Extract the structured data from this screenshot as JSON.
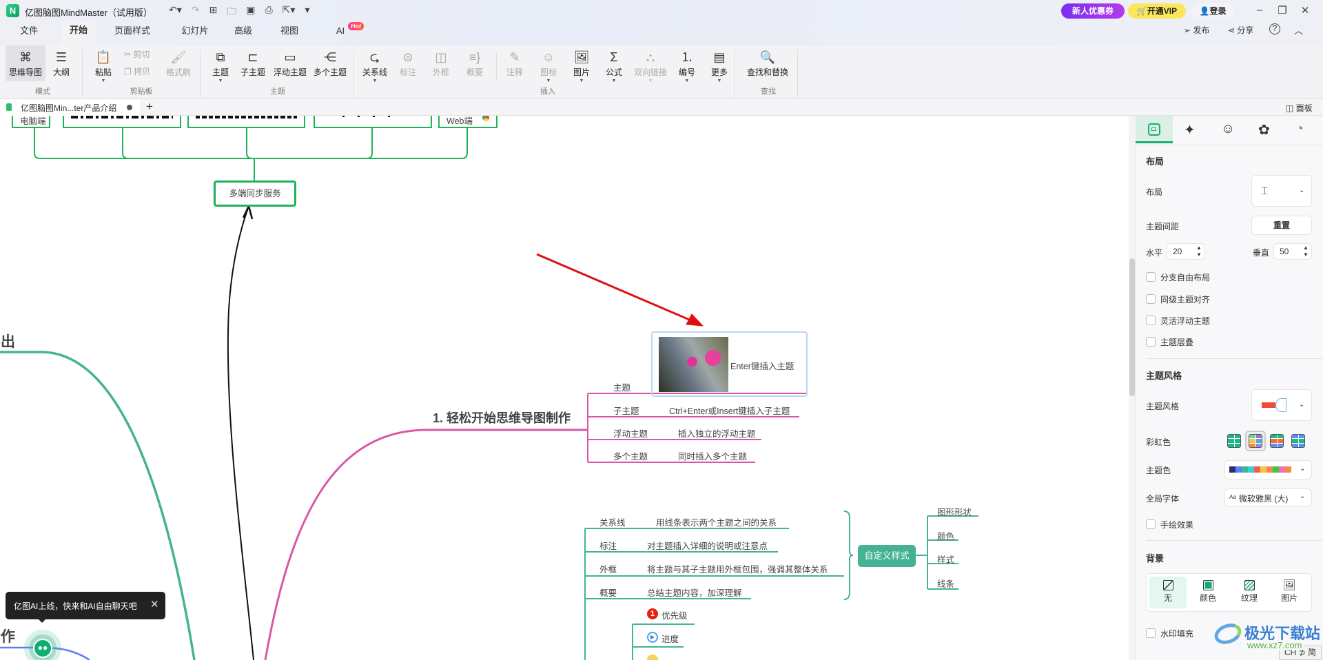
{
  "app": {
    "title": "亿图脑图MindMaster（试用版）",
    "coupon": "新人优惠券",
    "vip": "开通VIP",
    "login": "登录",
    "publish": "发布",
    "share": "分享",
    "help": "?",
    "minimize": "–",
    "maximize": "❐",
    "close": "✕"
  },
  "menu_tabs": [
    "文件",
    "开始",
    "页面样式",
    "幻灯片",
    "高级",
    "视图",
    "AI"
  ],
  "hot_badge": "Hot",
  "ribbon": {
    "groups": [
      "模式",
      "剪贴板",
      "主题",
      "插入",
      "查找"
    ],
    "items": {
      "mindmap": "思维导图",
      "outline": "大纲",
      "paste": "粘贴",
      "cut": "剪切",
      "copy": "拷贝",
      "format_painter": "格式刷",
      "topic": "主题",
      "subtopic": "子主题",
      "floating": "浮动主题",
      "multiple": "多个主题",
      "relation": "关系线",
      "callout": "标注",
      "boundary": "外框",
      "summary": "概要",
      "note": "注释",
      "icon": "图标",
      "image": "图片",
      "formula": "公式",
      "bilink": "双向链接",
      "numbering": "编号",
      "more": "更多",
      "find_replace": "查找和替换"
    }
  },
  "doc_tab": {
    "title": "亿图脑图Min...ter产品介绍",
    "add": "+",
    "panel_toggle": "面板"
  },
  "canvas": {
    "top_boxes": [
      "电脑端",
      "Web端"
    ],
    "sync_node": "多端同步服务",
    "left_partial_1": "导出",
    "left_partial_2": "合作",
    "main_topic": "1. 轻松开始思维导图制作",
    "selected_topic_text": "Enter键插入主题",
    "topic_rows": [
      {
        "label": "主题",
        "desc": ""
      },
      {
        "label": "子主题",
        "desc": "Ctrl+Enter或Insert键插入子主题"
      },
      {
        "label": "浮动主题",
        "desc": "插入独立的浮动主题"
      },
      {
        "label": "多个主题",
        "desc": "同时插入多个主题"
      }
    ],
    "style_rows": [
      {
        "label": "关系线",
        "desc": "用线条表示两个主题之间的关系"
      },
      {
        "label": "标注",
        "desc": "对主题插入详细的说明或注意点"
      },
      {
        "label": "外框",
        "desc": "将主题与其子主题用外框包围，强调其整体关系"
      },
      {
        "label": "概要",
        "desc": "总结主题内容，加深理解"
      }
    ],
    "custom_style": "自定义样式",
    "custom_style_children": [
      "图形形状",
      "颜色",
      "样式",
      "线条"
    ],
    "marker_rows": [
      "优先级",
      "进度"
    ],
    "ai_tooltip": "亿图AI上线，快来和AI自由聊天吧"
  },
  "panel": {
    "layout_heading": "布局",
    "layout_label": "布局",
    "spacing_label": "主题间距",
    "reset": "重置",
    "horizontal_label": "水平",
    "horizontal_value": "20",
    "vertical_label": "垂直",
    "vertical_value": "50",
    "checkboxes": [
      "分支自由布局",
      "同级主题对齐",
      "灵活浮动主题",
      "主题层叠"
    ],
    "style_heading": "主题风格",
    "style_label": "主题风格",
    "rainbow_label": "彩虹色",
    "theme_color_label": "主题色",
    "theme_colors": [
      "#26306b",
      "#5b7ff5",
      "#45b393",
      "#3ccfcf",
      "#f25a5a",
      "#f2c744",
      "#f5884a",
      "#3cc83c",
      "#f26fc0",
      "#f5884a"
    ],
    "font_label": "全局字体",
    "font_value": "微软雅黑 (大)",
    "handdrawn": "手绘效果",
    "bg_heading": "背景",
    "bg_options": [
      "无",
      "颜色",
      "纹理",
      "图片"
    ],
    "watermark": "水印填充"
  },
  "colors": {
    "teal": "#45b393",
    "pink": "#d957a5",
    "green": "#1db35a",
    "blue": "#5b7ff5",
    "red_arrow": "#e01010"
  },
  "watermark_logo": {
    "name": "极光下载站",
    "url": "www.xz7.com"
  },
  "ime": "CH ⊅ 简"
}
